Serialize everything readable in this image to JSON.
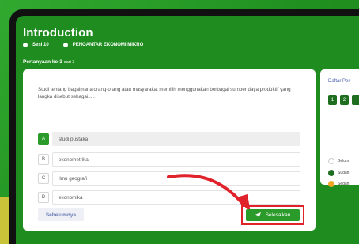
{
  "header": {
    "title": "Introduction",
    "session": "Sesi 10",
    "module": "PENGANTAR EKONOMI MIKRO",
    "question_label": "Pertanyaan ke-3",
    "question_total": "dari 3"
  },
  "question": {
    "text": "Studi tentang bagaimana orang-orang atau masyarakat memilih menggunakan berbagai sumber daya produktif yang langka disebut sebagai.....",
    "options": [
      {
        "letter": "A",
        "text": "studi pustaka",
        "selected": true
      },
      {
        "letter": "B",
        "text": "ekonometrika",
        "selected": false
      },
      {
        "letter": "C",
        "text": "ilmu geografi",
        "selected": false
      },
      {
        "letter": "D",
        "text": "ekonomika",
        "selected": false
      }
    ]
  },
  "actions": {
    "prev_label": "Sebelumnya",
    "finish_label": "Selesaikan",
    "finish_icon": "send-icon"
  },
  "sidebar": {
    "title": "Daftar Per",
    "numbers": [
      "1",
      "2",
      ""
    ],
    "legend": [
      {
        "label": "Belum",
        "color": "#ffffff"
      },
      {
        "label": "Sudah",
        "color": "#1f6e1f"
      },
      {
        "label": "Sedan",
        "color": "#f2a627"
      }
    ]
  },
  "colors": {
    "primary": "#2a9a2a",
    "highlight": "#e0222b",
    "header_bg": "#1f8c1f"
  }
}
